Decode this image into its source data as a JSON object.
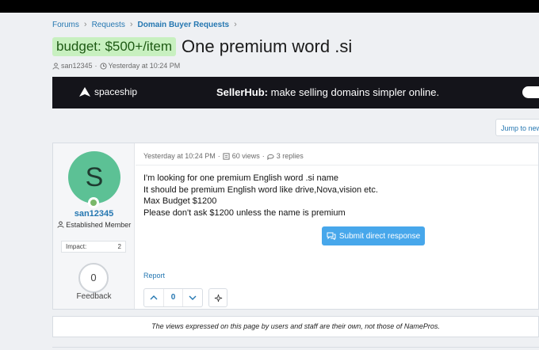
{
  "breadcrumbs": [
    "Forums",
    "Requests",
    "Domain Buyer Requests"
  ],
  "thread": {
    "prefix": "budget: $500+/item",
    "title": "One premium word .si",
    "author": "san12345",
    "date": "Yesterday at 10:24 PM"
  },
  "banner": {
    "logo_text": "spaceship",
    "brand": "SellerHub:",
    "tagline": " make selling domains simpler online."
  },
  "jump_label": "Jump to new",
  "post": {
    "username": "san12345",
    "user_title": "Established Member",
    "impact_label": "Impact:",
    "impact_value": "2",
    "feedback_count": "0",
    "feedback_label": "Feedback",
    "date": "Yesterday at 10:24 PM",
    "views": "60 views",
    "replies": "3 replies",
    "lines": [
      "I'm looking for one premium English word .si name",
      "It should be premium English word like drive,Nova,vision etc.",
      "Max Budget $1200",
      "Please don't ask $1200 unless the name is premium"
    ],
    "submit_label": "Submit direct response",
    "report_label": "Report",
    "vote_count": "0"
  },
  "footer_text": "The views expressed on this page by users and staff are their own, not those of NamePros."
}
